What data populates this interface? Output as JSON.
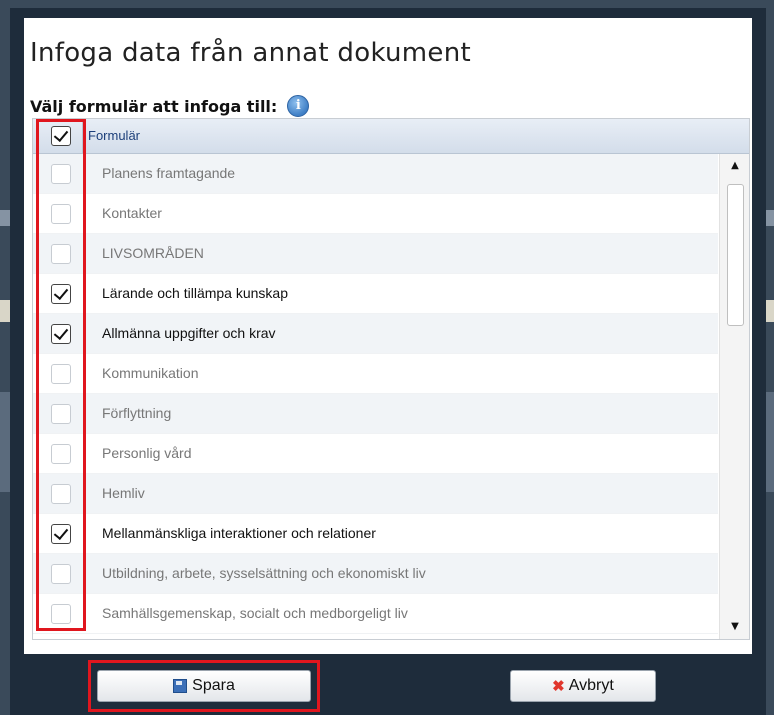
{
  "dialog": {
    "title": "Infoga data från annat dokument",
    "subtitle": "Välj formulär att infoga till:",
    "info_icon_glyph": "i"
  },
  "list": {
    "header": {
      "label": "Formulär",
      "checked": true
    },
    "items": [
      {
        "label": "Planens framtagande",
        "checked": false
      },
      {
        "label": "Kontakter",
        "checked": false
      },
      {
        "label": "LIVSOMRÅDEN",
        "checked": false
      },
      {
        "label": "Lärande och tillämpa kunskap",
        "checked": true
      },
      {
        "label": "Allmänna uppgifter och krav",
        "checked": true
      },
      {
        "label": "Kommunikation",
        "checked": false
      },
      {
        "label": "Förflyttning",
        "checked": false
      },
      {
        "label": "Personlig vård",
        "checked": false
      },
      {
        "label": "Hemliv",
        "checked": false
      },
      {
        "label": "Mellanmänskliga interaktioner och relationer",
        "checked": true
      },
      {
        "label": "Utbildning, arbete, sysselsättning och ekonomiskt liv",
        "checked": false
      },
      {
        "label": "Samhällsgemenskap, socialt och medborgeligt liv",
        "checked": false
      }
    ]
  },
  "buttons": {
    "save_label": "Spara",
    "cancel_label": "Avbryt",
    "cancel_icon_glyph": "✖"
  },
  "colors": {
    "highlight": "#e0161e",
    "dialog_frame": "#1e2c3b",
    "header_text": "#1c3f7a"
  },
  "icons": {
    "info": "info-circle-icon",
    "save": "floppy-disk-icon",
    "cancel": "red-x-icon",
    "scroll_up": "triangle-up-icon",
    "scroll_down": "triangle-down-icon"
  }
}
